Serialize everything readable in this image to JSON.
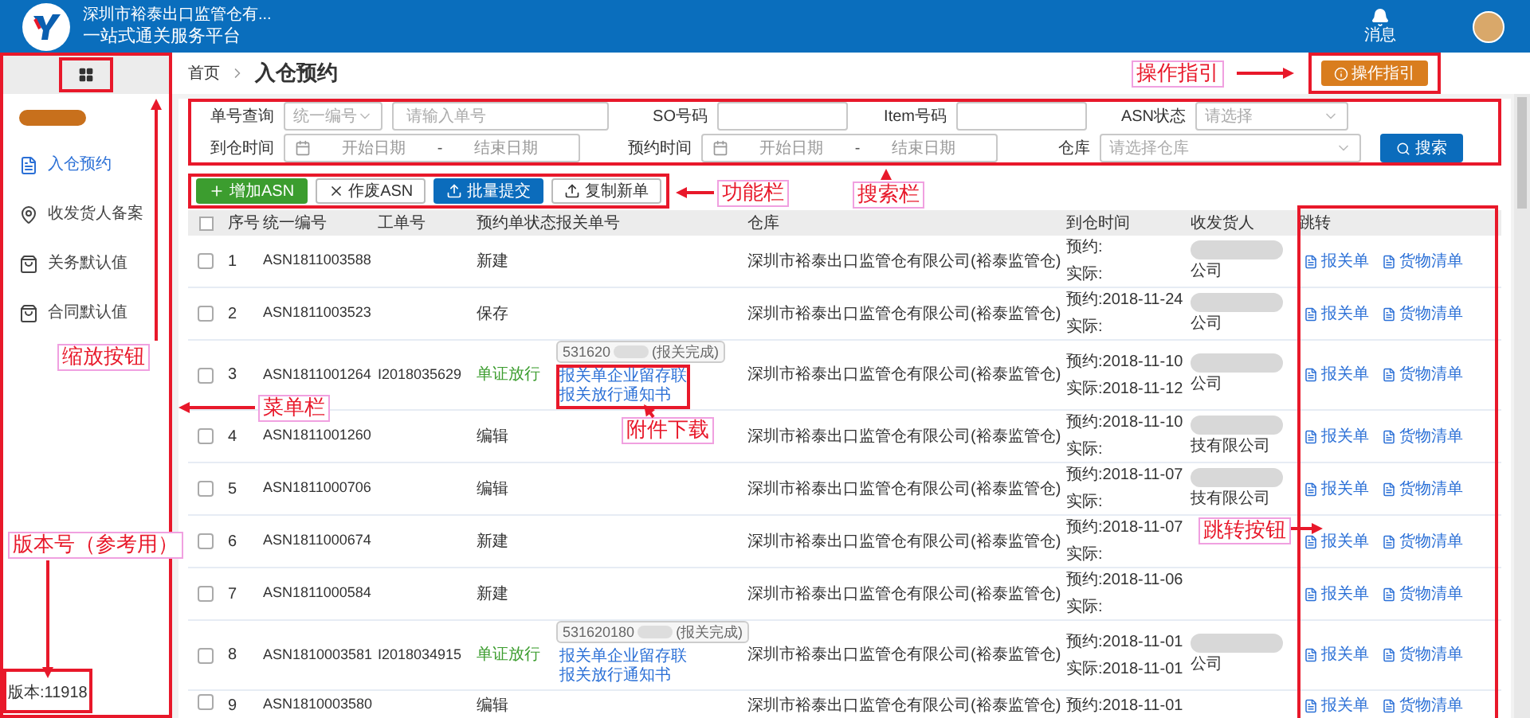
{
  "header": {
    "company": "深圳市裕泰出口监管仓有...",
    "platform": "一站式通关服务平台",
    "notice_label": "消息"
  },
  "sidebar": {
    "items": [
      {
        "label": "入仓预约",
        "selected": true
      },
      {
        "label": "收发货人备案",
        "selected": false
      },
      {
        "label": "关务默认值",
        "selected": false
      },
      {
        "label": "合同默认值",
        "selected": false
      }
    ],
    "version": "版本:11918"
  },
  "breadcrumb": {
    "home": "首页",
    "current": "入仓预约"
  },
  "guide_button": "操作指引",
  "search": {
    "order_label": "单号查询",
    "order_type": "统一编号",
    "order_placeholder": "请输入单号",
    "so_label": "SO号码",
    "item_label": "Item号码",
    "asn_label": "ASN状态",
    "asn_placeholder": "请选择",
    "arrive_label": "到仓时间",
    "arrive_range": {
      "start": "开始日期",
      "sep": "-",
      "end": "结束日期"
    },
    "book_label": "预约时间",
    "book_range": {
      "start": "开始日期",
      "sep": "-",
      "end": "结束日期"
    },
    "warehouse_label": "仓库",
    "warehouse_placeholder": "请选择仓库",
    "search_button": "搜索"
  },
  "actions": [
    {
      "label": "增加ASN",
      "kind": "add"
    },
    {
      "label": "作废ASN",
      "kind": "void"
    },
    {
      "label": "批量提交",
      "kind": "submit"
    },
    {
      "label": "复制新单",
      "kind": "copy"
    }
  ],
  "table": {
    "select_all": false,
    "columns": [
      "序号",
      "统一编号",
      "工单号",
      "预约单状态",
      "报关单号",
      "仓库",
      "到仓时间",
      "收发货人",
      "跳转"
    ],
    "rows": [
      {
        "selected": false,
        "seq": "1",
        "id": "ASN1811003588",
        "work": "",
        "status": "新建",
        "released": false,
        "customs": null,
        "warehouse": "深圳市裕泰出口监管仓有限公司(裕泰监管仓)",
        "booked": "预约:",
        "actual": "实际:",
        "receiver": "公司",
        "blurred": true,
        "links": [
          "报关单",
          "货物清单"
        ]
      },
      {
        "selected": false,
        "seq": "2",
        "id": "ASN1811003523",
        "work": "",
        "status": "保存",
        "released": false,
        "customs": null,
        "warehouse": "深圳市裕泰出口监管仓有限公司(裕泰监管仓)",
        "booked": "预约:2018-11-24",
        "actual": "实际:",
        "receiver": "公司",
        "blurred": true,
        "links": [
          "报关单",
          "货物清单"
        ]
      },
      {
        "selected": false,
        "seq": "3",
        "id": "ASN1811001264",
        "work": "I2018035629",
        "status": "单证放行",
        "released": true,
        "customs": {
          "number": "531620",
          "result": "(报关完成)",
          "files": [
            "报关单企业留存联",
            "报关放行通知书"
          ]
        },
        "warehouse": "深圳市裕泰出口监管仓有限公司(裕泰监管仓)",
        "booked": "预约:2018-11-10",
        "actual": "实际:2018-11-12",
        "receiver": "公司",
        "blurred": true,
        "links": [
          "报关单",
          "货物清单"
        ]
      },
      {
        "selected": false,
        "seq": "4",
        "id": "ASN1811001260",
        "work": "",
        "status": "编辑",
        "released": false,
        "customs": null,
        "warehouse": "深圳市裕泰出口监管仓有限公司(裕泰监管仓)",
        "booked": "预约:2018-11-10",
        "actual": "实际:",
        "receiver": "技有限公司",
        "blurred": true,
        "links": [
          "报关单",
          "货物清单"
        ]
      },
      {
        "selected": false,
        "seq": "5",
        "id": "ASN1811000706",
        "work": "",
        "status": "编辑",
        "released": false,
        "customs": null,
        "warehouse": "深圳市裕泰出口监管仓有限公司(裕泰监管仓)",
        "booked": "预约:2018-11-07",
        "actual": "实际:",
        "receiver": "技有限公司",
        "blurred": true,
        "links": [
          "报关单",
          "货物清单"
        ]
      },
      {
        "selected": false,
        "seq": "6",
        "id": "ASN1811000674",
        "work": "",
        "status": "新建",
        "released": false,
        "customs": null,
        "warehouse": "深圳市裕泰出口监管仓有限公司(裕泰监管仓)",
        "booked": "预约:2018-11-07",
        "actual": "实际:",
        "receiver": "",
        "blurred": false,
        "links": [
          "报关单",
          "货物清单"
        ]
      },
      {
        "selected": false,
        "seq": "7",
        "id": "ASN1811000584",
        "work": "",
        "status": "新建",
        "released": false,
        "customs": null,
        "warehouse": "深圳市裕泰出口监管仓有限公司(裕泰监管仓)",
        "booked": "预约:2018-11-06",
        "actual": "实际:",
        "receiver": "",
        "blurred": false,
        "links": [
          "报关单",
          "货物清单"
        ]
      },
      {
        "selected": false,
        "seq": "8",
        "id": "ASN1810003581",
        "work": "I2018034915",
        "status": "单证放行",
        "released": true,
        "customs": {
          "number": "531620180",
          "result": "(报关完成)",
          "files": [
            "报关单企业留存联",
            "报关放行通知书"
          ]
        },
        "warehouse": "深圳市裕泰出口监管仓有限公司(裕泰监管仓)",
        "booked": "预约:2018-11-01",
        "actual": "实际:2018-11-01",
        "receiver": "公司",
        "blurred": true,
        "links": [
          "报关单",
          "货物清单"
        ]
      },
      {
        "selected": false,
        "seq": "9",
        "id": "ASN1810003580",
        "work": "",
        "status": "编辑",
        "released": false,
        "customs": null,
        "warehouse": "深圳市裕泰出口监管仓有限公司(裕泰监管仓)",
        "booked": "预约:2018-11-01",
        "actual": "",
        "receiver": "",
        "blurred": false,
        "links": [
          "报关单",
          "货物清单"
        ]
      }
    ]
  },
  "annotations": [
    {
      "label": "操作指引"
    },
    {
      "label": "搜索栏"
    },
    {
      "label": "功能栏"
    },
    {
      "label": "附件下载"
    },
    {
      "label": "缩放按钮"
    },
    {
      "label": "菜单栏"
    },
    {
      "label": "版本号（参考用）"
    },
    {
      "label": "跳转按钮"
    }
  ]
}
